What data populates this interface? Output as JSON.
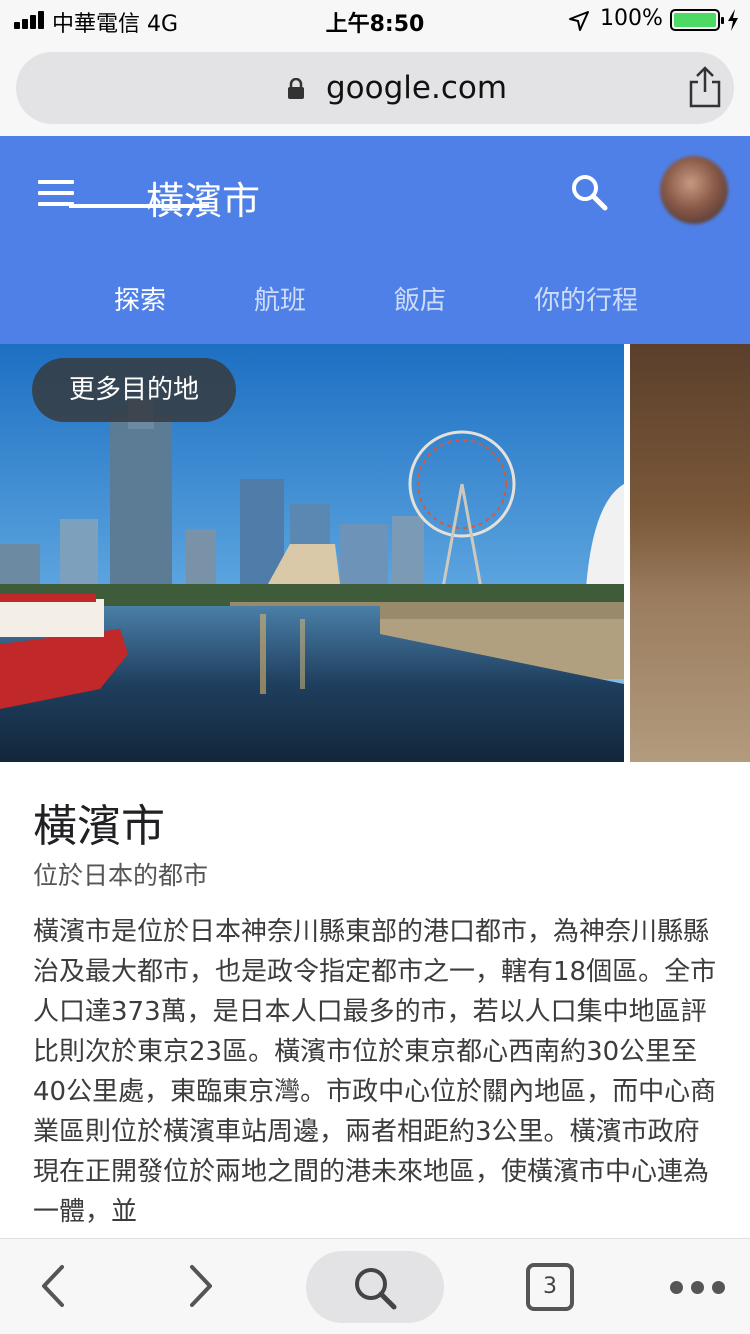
{
  "status_bar": {
    "carrier": "中華電信   4G",
    "time": "上午8:50",
    "battery_percent": "100%",
    "battery_level": 1.0
  },
  "browser": {
    "url": "google.com",
    "tab_count": "3"
  },
  "header": {
    "title": "橫濱市",
    "tabs": [
      {
        "label": "探索",
        "active": true
      },
      {
        "label": "航班",
        "active": false
      },
      {
        "label": "飯店",
        "active": false
      },
      {
        "label": "你的行程",
        "active": false
      }
    ]
  },
  "hero": {
    "more_destinations_label": "更多目的地"
  },
  "place": {
    "title": "橫濱市",
    "subtitle": "位於日本的都市",
    "description": "橫濱市是位於日本神奈川縣東部的港口都市，為神奈川縣縣治及最大都市，也是政令指定都市之一，轄有18個區。全市人口達373萬，是日本人口最多的市，若以人口集中地區評比則次於東京23區。橫濱市位於東京都心西南約30公里至40公里處，東臨東京灣。市政中心位於關內地區，而中心商業區則位於橫濱車站周邊，兩者相距約3公里。橫濱市政府現在正開發位於兩地之間的港未來地區，使橫濱市中心連為一體，並"
  },
  "colors": {
    "header_bg": "#4f80e8",
    "battery_green": "#4cd964"
  }
}
